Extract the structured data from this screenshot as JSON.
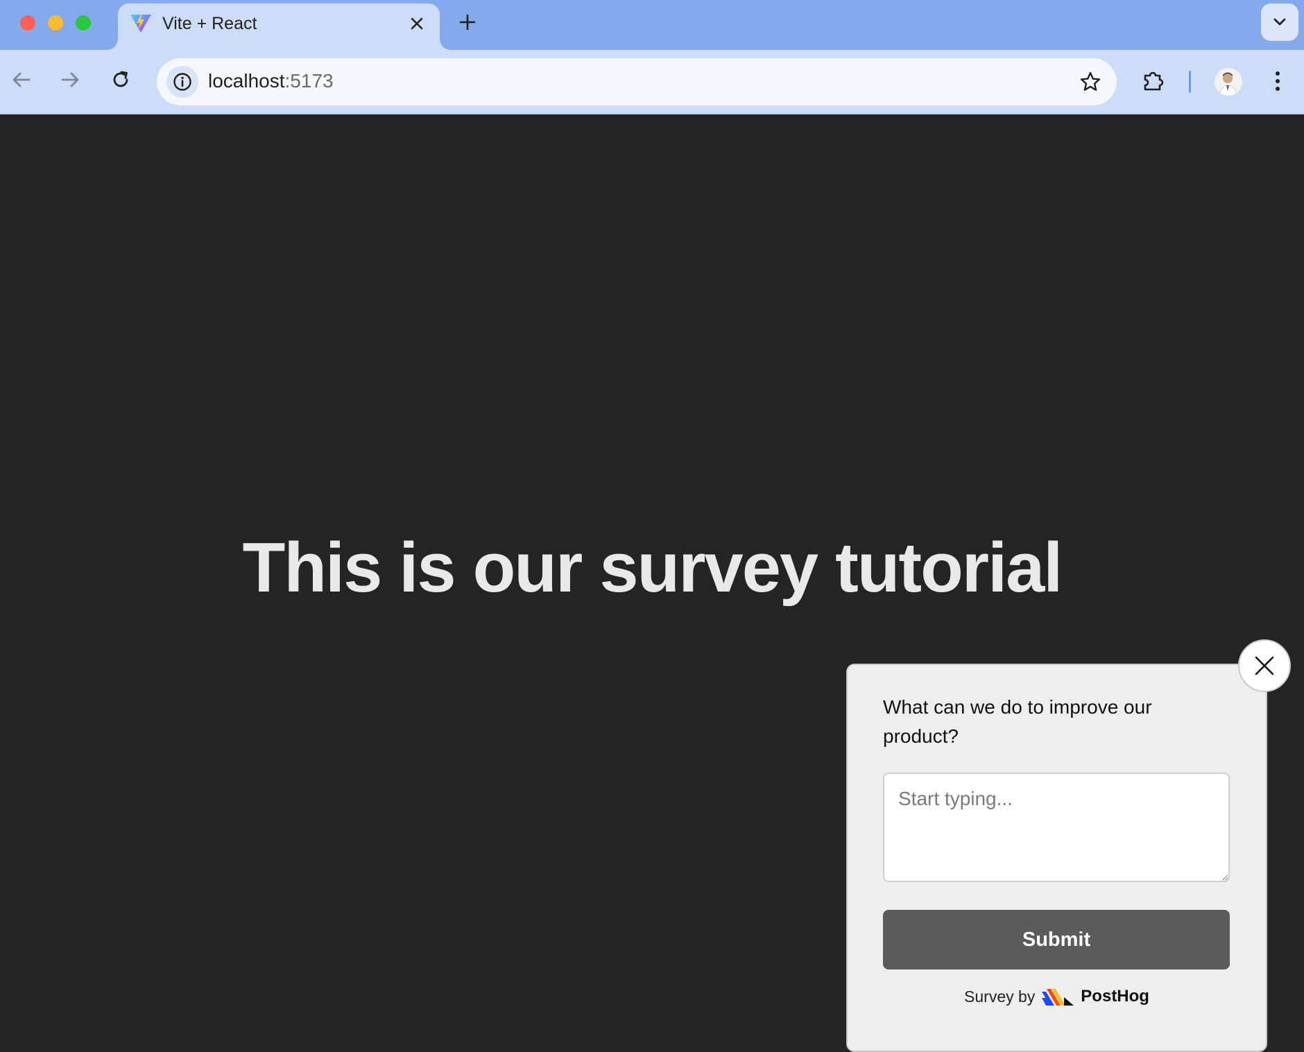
{
  "browser": {
    "tab": {
      "title": "Vite + React",
      "favicon": "vite-icon"
    },
    "address_bar": {
      "host": "localhost",
      "port": ":5173"
    },
    "icons": {
      "back": "arrow-left-icon",
      "forward": "arrow-right-icon",
      "reload": "reload-icon",
      "site_info": "info-icon",
      "bookmark": "star-icon",
      "extensions": "puzzle-icon",
      "menu": "kebab-menu-icon",
      "tab_search": "chevron-down-icon",
      "new_tab": "plus-icon",
      "close_tab": "close-icon"
    },
    "colors": {
      "tabstrip": "#85aaec",
      "toolbar": "#cdddf7"
    }
  },
  "page": {
    "heading": "This is our survey tutorial",
    "background": "#242424"
  },
  "survey": {
    "question": "What can we do to improve our product?",
    "input_value": "",
    "input_placeholder": "Start typing...",
    "submit_label": "Submit",
    "footer_prefix": "Survey by",
    "brand_name": "PostHog",
    "colors": {
      "panel": "#eeeeee",
      "button": "#5b5b5b"
    }
  }
}
